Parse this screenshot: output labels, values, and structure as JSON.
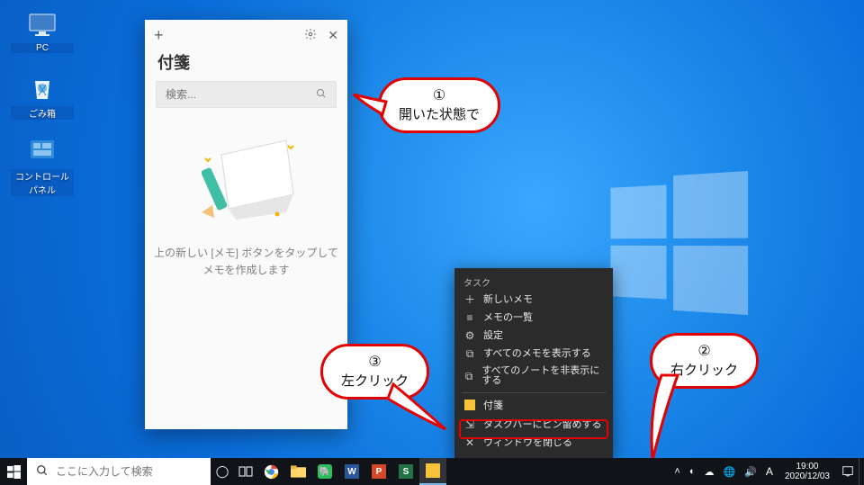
{
  "desktop_icons": [
    {
      "label": "PC",
      "name": "desktop-icon-pc"
    },
    {
      "label": "ごみ箱",
      "name": "desktop-icon-recycle-bin"
    },
    {
      "label": "コントロール パネル",
      "name": "desktop-icon-control-panel"
    }
  ],
  "sticky": {
    "title": "付箋",
    "search_placeholder": "検索...",
    "empty_hint_line1": "上の新しい [メモ] ボタンをタップして",
    "empty_hint_line2": "メモを作成します"
  },
  "jumplist": {
    "section_task": "タスク",
    "items_top": [
      {
        "icon": "＋",
        "label": "新しいメモ",
        "name": "jump-item-new-note"
      },
      {
        "icon": "≡",
        "label": "メモの一覧",
        "name": "jump-item-note-list"
      },
      {
        "icon": "⚙",
        "label": "設定",
        "name": "jump-item-settings"
      },
      {
        "icon": "⧉",
        "label": "すべてのメモを表示する",
        "name": "jump-item-show-all"
      },
      {
        "icon": "⧉",
        "label": "すべてのノートを非表示にする",
        "name": "jump-item-hide-all"
      }
    ],
    "app_label": "付箋",
    "pin_label": "タスクバーにピン留めする",
    "close_label": "ウィンドウを閉じる"
  },
  "callouts": {
    "c1": {
      "num": "①",
      "text": "開いた状態で"
    },
    "c2": {
      "num": "②",
      "text": "右クリック"
    },
    "c3": {
      "num": "③",
      "text": "左クリック"
    }
  },
  "taskbar": {
    "search_placeholder": "ここに入力して検索"
  },
  "tray": {
    "time": "19:00",
    "date": "2020/12/03",
    "ime": "A"
  }
}
